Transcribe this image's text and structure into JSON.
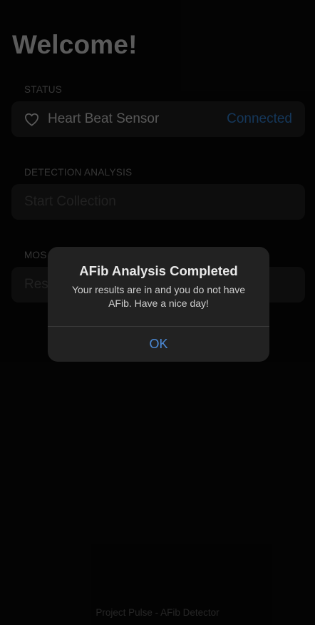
{
  "page": {
    "title": "Welcome!",
    "footer": "Project Pulse - AFib Detector"
  },
  "status_section": {
    "header": "STATUS",
    "sensor_label": "Heart Beat Sensor",
    "sensor_status": "Connected",
    "icon": "heart-outline-icon"
  },
  "detection_section": {
    "header": "DETECTION ANALYSIS",
    "action_label": "Start Collection"
  },
  "recent_section": {
    "header": "MOS",
    "item_label": "Res"
  },
  "alert": {
    "title": "AFib Analysis Completed",
    "message": "Your results are in and you do not have AFib. Have a nice day!",
    "ok_label": "OK"
  },
  "colors": {
    "accent": "#4c8ad6",
    "connected": "#1c4a78",
    "background": "#050505",
    "alert_background": "#222222"
  }
}
